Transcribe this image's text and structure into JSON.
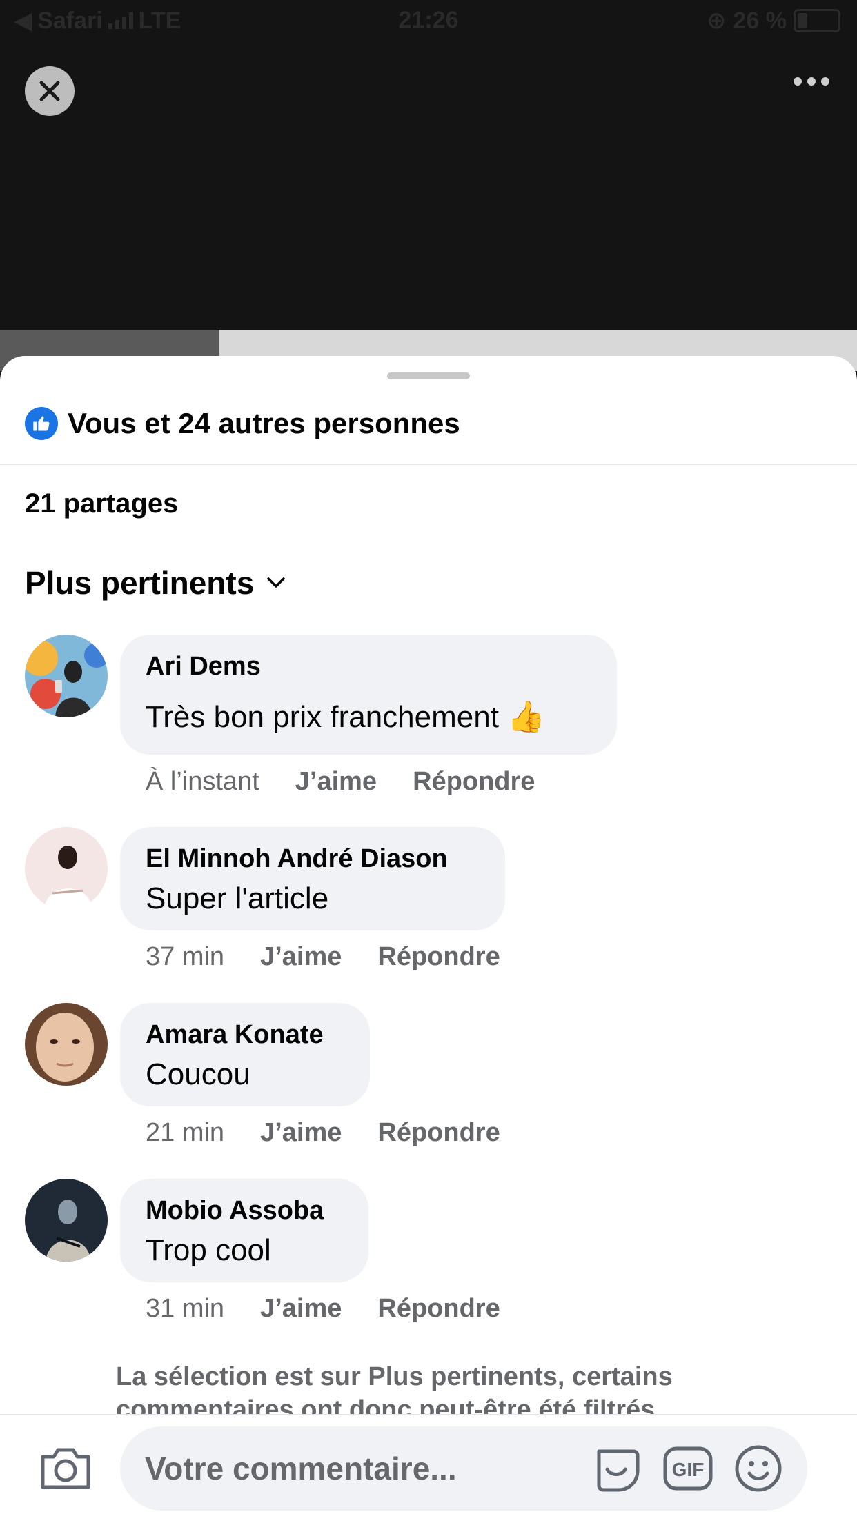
{
  "status_bar": {
    "back_app": "Safari",
    "network": "LTE",
    "time": "21:26",
    "battery": "26 %",
    "battery_level": 0.26
  },
  "post": {
    "reactions_text": "Vous et 24 autres personnes",
    "shares_text": "21 partages",
    "sort_label": "Plus pertinents"
  },
  "comments": [
    {
      "author": "Ari Dems",
      "text": "Très bon prix franchement 👍",
      "time": "À l’instant",
      "like": "J’aime",
      "reply": "Répondre",
      "avatar_colors": [
        "#f4b63f",
        "#3f7fd6",
        "#e24a3b",
        "#222222"
      ]
    },
    {
      "author": "El Minnoh André Diason",
      "text": "Super l'article",
      "time": "37 min",
      "like": "J’aime",
      "reply": "Répondre",
      "avatar_colors": [
        "#f5e6e6",
        "#2b1b16",
        "#ffffff",
        "#c7a8a0"
      ]
    },
    {
      "author": "Amara Konate",
      "text": "Coucou",
      "time": "21 min",
      "like": "J’aime",
      "reply": "Répondre",
      "avatar_colors": [
        "#6a4630",
        "#e9c3a6",
        "#d8a888",
        "#3a2419"
      ]
    },
    {
      "author": "Mobio Assoba",
      "text": "Trop cool",
      "time": "31 min",
      "like": "J’aime",
      "reply": "Répondre",
      "avatar_colors": [
        "#1f2a36",
        "#8a9aa8",
        "#c9c2b6",
        "#0f141a"
      ]
    }
  ],
  "filter_note": "La sélection est sur Plus pertinents, certains commentaires ont donc peut-être été filtrés.",
  "composer": {
    "placeholder": "Votre commentaire...",
    "gif_label": "GIF"
  },
  "colors": {
    "facebook_blue": "#1b74e4",
    "bubble_bg": "#f0f2f5",
    "secondary_text": "#65676b"
  }
}
